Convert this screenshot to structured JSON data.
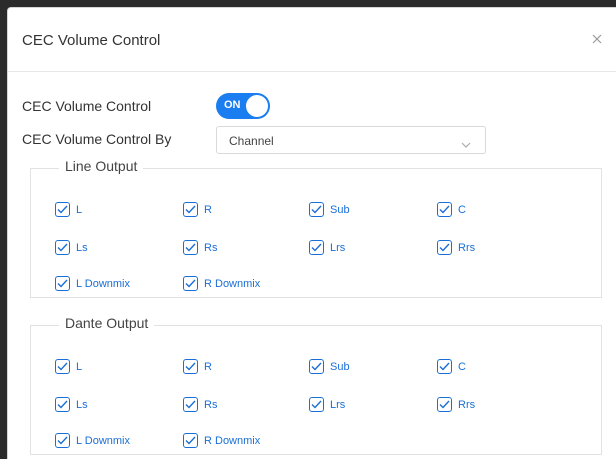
{
  "dialog": {
    "title": "CEC Volume Control",
    "close_icon": "close-icon"
  },
  "toggle_row": {
    "label": "CEC Volume Control",
    "state": "ON"
  },
  "select_row": {
    "label": "CEC Volume Control By",
    "value": "Channel"
  },
  "line_output": {
    "legend": "Line Output",
    "items": [
      "L",
      "R",
      "Sub",
      "C",
      "Ls",
      "Rs",
      "Lrs",
      "Rrs",
      "L Downmix",
      "R Downmix"
    ]
  },
  "dante_output": {
    "legend": "Dante Output",
    "items": [
      "L",
      "R",
      "Sub",
      "C",
      "Ls",
      "Rs",
      "Lrs",
      "Rrs",
      "L Downmix",
      "R Downmix"
    ]
  },
  "colors": {
    "accent": "#1a7df0",
    "checkbox": "#1a6fd6"
  }
}
